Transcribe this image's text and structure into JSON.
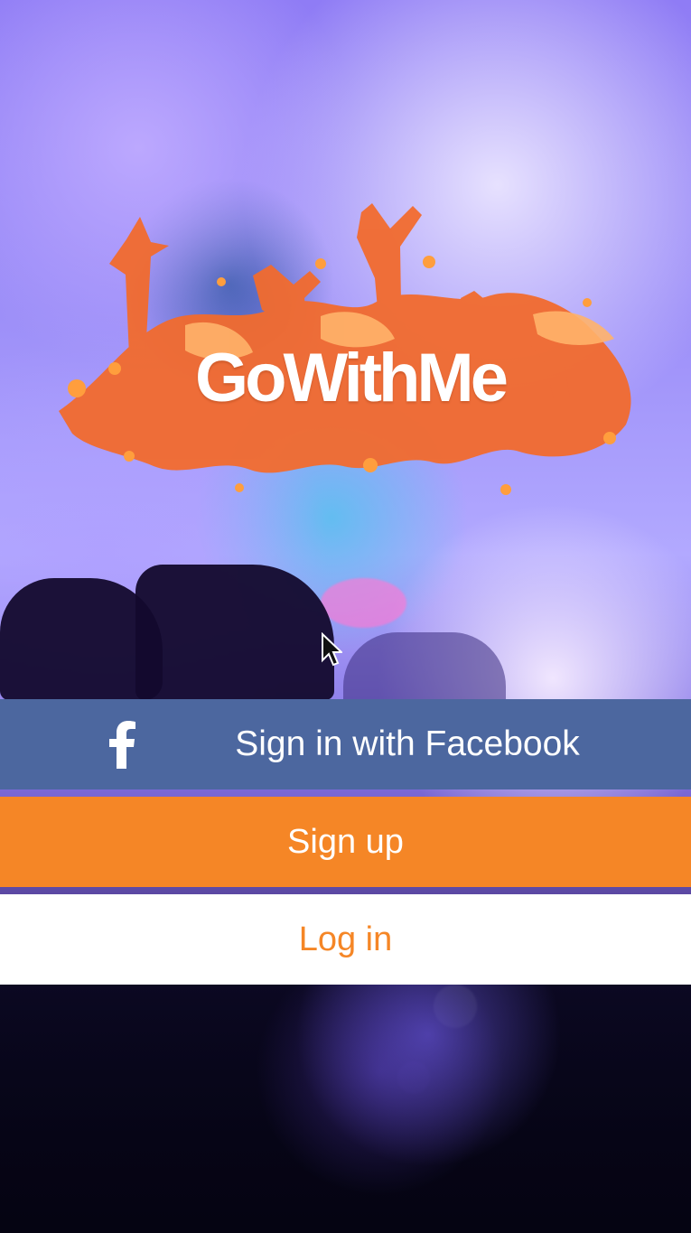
{
  "app": {
    "name": "GoWithMe"
  },
  "logo": {
    "text": "GoWithMe",
    "accent_color": "#f26b2e"
  },
  "actions": {
    "facebook": {
      "label": "Sign in with Facebook",
      "icon": "facebook-icon",
      "color": "#4c679f"
    },
    "signup": {
      "label": "Sign up",
      "color": "#f58626"
    },
    "login": {
      "label": "Log in",
      "color": "#ffffff",
      "text_color": "#f58626"
    }
  },
  "pointer": {
    "icon": "cursor-icon"
  }
}
